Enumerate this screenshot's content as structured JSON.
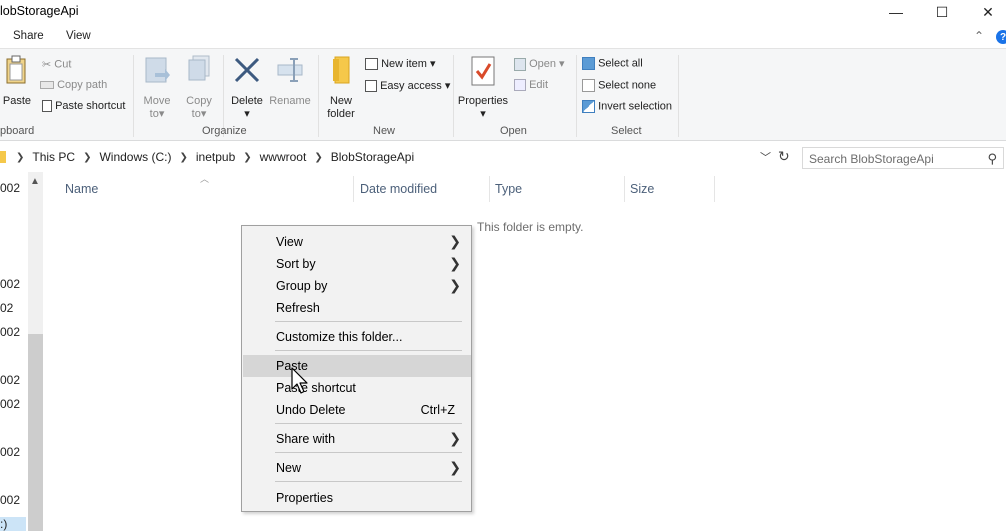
{
  "window": {
    "title": "lobStorageApi",
    "minimize_glyph": "—",
    "maximize_glyph": "☐",
    "close_glyph": "✕"
  },
  "tabs": [
    {
      "label": "Share"
    },
    {
      "label": "View"
    }
  ],
  "ribbon": {
    "clipboard": {
      "paste": "Paste",
      "cut": "Cut",
      "copy_path": "Copy path",
      "paste_shortcut": "Paste shortcut",
      "label": "pboard"
    },
    "organize": {
      "move_to": "Move",
      "move_to_2": "to",
      "copy_to": "Copy",
      "copy_to_2": "to",
      "delete": "Delete",
      "rename": "Rename",
      "label": "Organize"
    },
    "new": {
      "new_folder": "New",
      "new_folder_2": "folder",
      "new_item": "New item",
      "easy_access": "Easy access",
      "label": "New"
    },
    "open": {
      "properties": "Properties",
      "open": "Open",
      "edit": "Edit",
      "label": "Open"
    },
    "select": {
      "select_all": "Select all",
      "select_none": "Select none",
      "invert_selection": "Invert selection",
      "label": "Select"
    }
  },
  "address": {
    "crumbs": [
      "This PC",
      "Windows (C:)",
      "inetpub",
      "wwwroot",
      "BlobStorageApi"
    ],
    "search_placeholder": "Search BlobStorageApi"
  },
  "nav_items": [
    {
      "label": "002"
    },
    {
      "label": "002"
    },
    {
      "label": "02"
    },
    {
      "label": "002"
    },
    {
      "label": "002"
    },
    {
      "label": "002"
    },
    {
      "label": "002"
    },
    {
      "label": "002"
    },
    {
      "label": ":)"
    }
  ],
  "columns": [
    "Name",
    "Date modified",
    "Type",
    "Size"
  ],
  "empty_message": "This folder is empty.",
  "context_menu": {
    "view": "View",
    "sort_by": "Sort by",
    "group_by": "Group by",
    "refresh": "Refresh",
    "customize": "Customize this folder...",
    "paste": "Paste",
    "paste_shortcut": "Paste shortcut",
    "undo_delete": "Undo Delete",
    "undo_shortcut": "Ctrl+Z",
    "share_with": "Share with",
    "new": "New",
    "properties": "Properties"
  },
  "colors": {
    "accent": "#1a73e8",
    "ribbon_bg": "#f5f6f7",
    "menu_bg": "#f2f2f2",
    "menu_highlight": "#d6d6d6"
  }
}
